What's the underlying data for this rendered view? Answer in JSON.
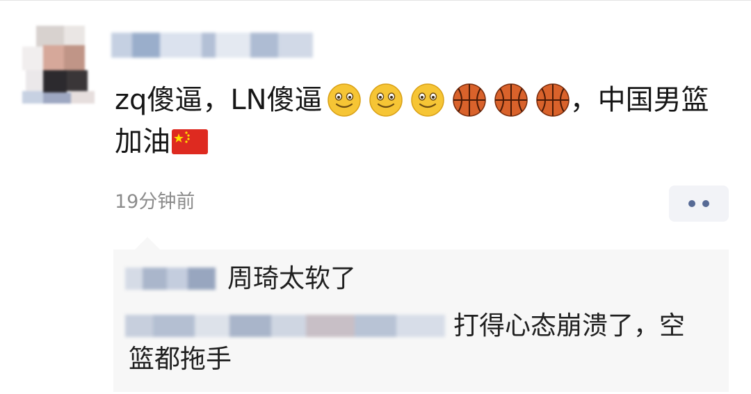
{
  "post": {
    "avatar_icon": "user-avatar-pixelated",
    "username": "",
    "content_parts": [
      "zq傻逼，LN傻逼",
      "，中国男篮加油"
    ],
    "emojis_smile": [
      "smiling-face-emoji",
      "smiling-face-emoji",
      "smiling-face-emoji"
    ],
    "emojis_basketball": [
      "basketball-emoji",
      "basketball-emoji",
      "basketball-emoji"
    ],
    "flag": "china-flag-emoji",
    "time": "19分钟前",
    "more_icon": "two-dots-more-icon"
  },
  "comments": [
    {
      "user": "",
      "text": "周琦太软了"
    },
    {
      "user": "",
      "text": "打得心态崩溃了，空",
      "text_cont": "篮都拖手"
    }
  ],
  "colors": {
    "link": "#576a95",
    "reply_bg": "#f7f7f7",
    "time": "#8b8b8b"
  }
}
